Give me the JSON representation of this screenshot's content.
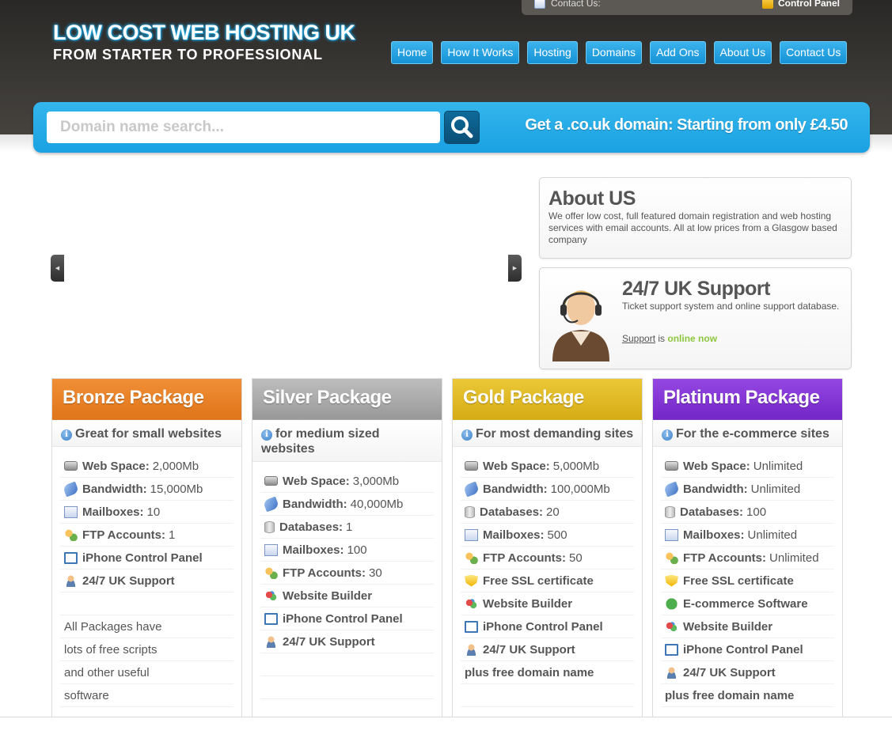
{
  "topbar": {
    "contact_label": "Contact Us:",
    "control_panel_label": "Control Panel"
  },
  "logo": {
    "main": "LOW COST WEB HOSTING UK",
    "sub": "FROM STARTER TO PROFESSIONAL"
  },
  "nav": [
    "Home",
    "How It Works",
    "Hosting",
    "Domains",
    "Add Ons",
    "About Us",
    "Contact Us"
  ],
  "search": {
    "placeholder": "Domain name search...",
    "promo": "Get a .co.uk domain: Starting from only £4.50"
  },
  "about": {
    "title": "About US",
    "text": "We offer low cost, full featured domain registration and web hosting services with email accounts. All at low prices from a Glasgow based company"
  },
  "support": {
    "title": "24/7 UK Support",
    "text": "Ticket support system and online support database.",
    "link_label": "Support",
    "is_label": "is",
    "online_label": "online now"
  },
  "colors": {
    "accent": "#1ba6e3",
    "bronze": "#e8801f",
    "silver": "#a8a8a8",
    "gold": "#dfb61e",
    "platinum": "#8436d6",
    "online": "#8cc63f"
  },
  "packages": [
    {
      "title": "Bronze Package",
      "subtitle": "Great for small websites",
      "features": [
        {
          "icon": "hard-drive-icon",
          "label": "Web Space:",
          "value": "2,000Mb"
        },
        {
          "icon": "bandwidth-icon",
          "label": "Bandwidth:",
          "value": "15,000Mb"
        },
        {
          "icon": "mailbox-icon",
          "label": "Mailboxes:",
          "value": "10"
        },
        {
          "icon": "ftp-accounts-icon",
          "label": "FTP Accounts:",
          "value": "1"
        },
        {
          "icon": "iphone-panel-icon",
          "label": "iPhone Control Panel",
          "value": ""
        },
        {
          "icon": "support-agent-icon",
          "label": "24/7 UK Support",
          "value": ""
        }
      ],
      "note_lines": [
        "All Packages have",
        "lots of free scripts",
        "and other useful",
        "software"
      ]
    },
    {
      "title": "Silver Package",
      "subtitle": "for medium sized websites",
      "features": [
        {
          "icon": "hard-drive-icon",
          "label": "Web Space:",
          "value": "3,000Mb"
        },
        {
          "icon": "bandwidth-icon",
          "label": "Bandwidth:",
          "value": "40,000Mb"
        },
        {
          "icon": "database-icon",
          "label": "Databases:",
          "value": "1"
        },
        {
          "icon": "mailbox-icon",
          "label": "Mailboxes:",
          "value": "100"
        },
        {
          "icon": "ftp-accounts-icon",
          "label": "FTP Accounts:",
          "value": "30"
        },
        {
          "icon": "website-builder-icon",
          "label": "Website Builder",
          "value": ""
        },
        {
          "icon": "iphone-panel-icon",
          "label": "iPhone Control Panel",
          "value": ""
        },
        {
          "icon": "support-agent-icon",
          "label": "24/7 UK Support",
          "value": ""
        }
      ]
    },
    {
      "title": "Gold Package",
      "subtitle": "For most demanding sites",
      "features": [
        {
          "icon": "hard-drive-icon",
          "label": "Web Space:",
          "value": "5,000Mb"
        },
        {
          "icon": "bandwidth-icon",
          "label": "Bandwidth:",
          "value": "100,000Mb"
        },
        {
          "icon": "database-icon",
          "label": "Databases:",
          "value": "20"
        },
        {
          "icon": "mailbox-icon",
          "label": "Mailboxes:",
          "value": "500"
        },
        {
          "icon": "ftp-accounts-icon",
          "label": "FTP Accounts:",
          "value": "50"
        },
        {
          "icon": "ssl-shield-icon",
          "label": "Free SSL certificate",
          "value": ""
        },
        {
          "icon": "website-builder-icon",
          "label": "Website Builder",
          "value": ""
        },
        {
          "icon": "iphone-panel-icon",
          "label": "iPhone Control Panel",
          "value": ""
        },
        {
          "icon": "support-agent-icon",
          "label": "24/7 UK Support",
          "value": ""
        }
      ],
      "extra": "plus free domain name"
    },
    {
      "title": "Platinum Package",
      "subtitle": "For the e-commerce sites",
      "features": [
        {
          "icon": "hard-drive-icon",
          "label": "Web Space:",
          "value": "Unlimited"
        },
        {
          "icon": "bandwidth-icon",
          "label": "Bandwidth:",
          "value": "Unlimited"
        },
        {
          "icon": "database-icon",
          "label": "Databases:",
          "value": "100"
        },
        {
          "icon": "mailbox-icon",
          "label": "Mailboxes:",
          "value": "Unlimited"
        },
        {
          "icon": "ftp-accounts-icon",
          "label": "FTP Accounts:",
          "value": "Unlimited"
        },
        {
          "icon": "ssl-shield-icon",
          "label": "Free SSL certificate",
          "value": ""
        },
        {
          "icon": "ecommerce-check-icon",
          "label": "E-commerce Software",
          "value": ""
        },
        {
          "icon": "website-builder-icon",
          "label": "Website Builder",
          "value": ""
        },
        {
          "icon": "iphone-panel-icon",
          "label": "iPhone Control Panel",
          "value": ""
        },
        {
          "icon": "support-agent-icon",
          "label": "24/7 UK Support",
          "value": ""
        }
      ],
      "extra": "plus free domain name"
    }
  ]
}
